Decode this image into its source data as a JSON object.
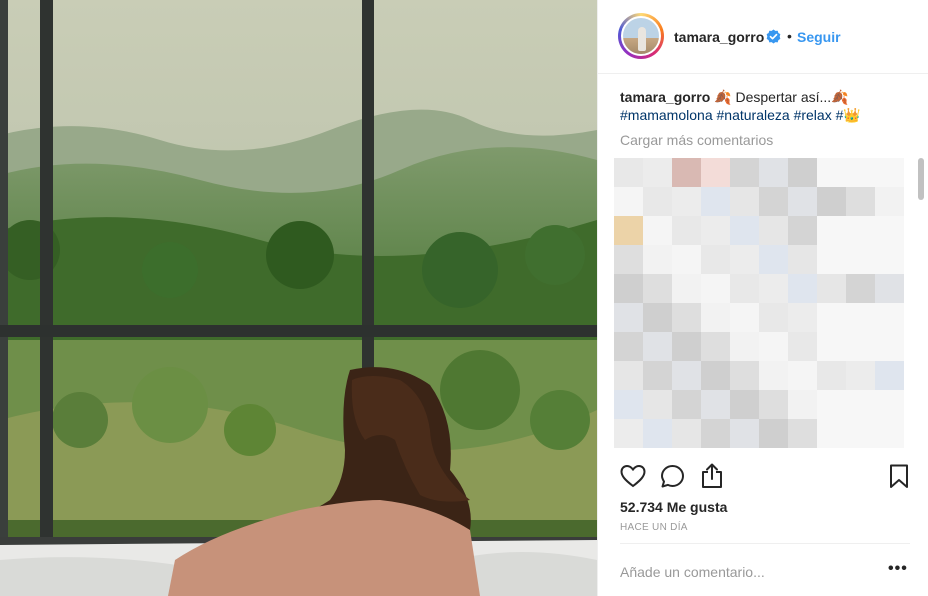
{
  "profile": {
    "username": "tamara_gorro",
    "separator": "•",
    "follow_label": "Seguir"
  },
  "caption": {
    "username": "tamara_gorro",
    "text_start": " 🍂 Despertar así...🍂",
    "hashtags": [
      "#mamamolona",
      "#naturaleza",
      "#relax",
      "#"
    ],
    "emoji_end": "👑"
  },
  "comments": {
    "load_more": "Cargar más comentarios"
  },
  "stats": {
    "likes": "52.734 Me gusta",
    "time": "HACE UN DÍA"
  },
  "add_comment": {
    "placeholder": "Añade un comentario...",
    "options": "•••"
  },
  "icons": {
    "like": "heart-icon",
    "comment": "comment-icon",
    "share": "share-icon",
    "save": "bookmark-icon",
    "verified": "verified-badge-icon"
  },
  "colors": {
    "link": "#3897f0",
    "hashtag": "#003569",
    "muted": "#999999"
  }
}
